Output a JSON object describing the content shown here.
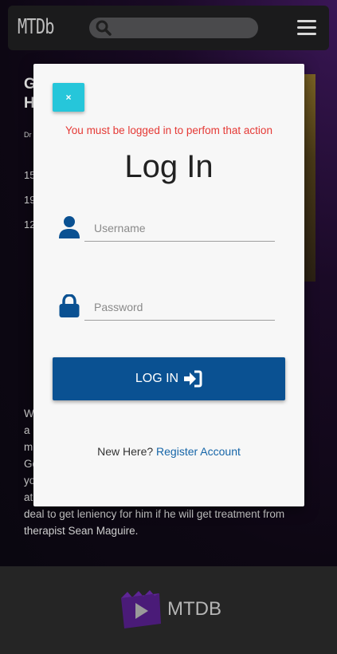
{
  "navbar": {
    "logo": "MTDb",
    "search_placeholder": "",
    "search_icon": "search-icon",
    "menu_icon": "hamburger-menu-icon"
  },
  "background": {
    "title_line1": "G",
    "title_line2": "H",
    "subtitle": "Dr",
    "lines": [
      "15",
      "19",
      "12"
    ],
    "paragraph_lines": [
      "W",
      "a",
      "m",
      "Go",
      "yo",
      "at"
    ],
    "paragraph_tail_1": "deal to get leniency for him if he will get treatment from",
    "paragraph_tail_2": "therapist Sean Maguire."
  },
  "modal": {
    "close_label": "×",
    "error_message": "You must be logged in to perfom that action",
    "title": "Log In",
    "username_placeholder": "Username",
    "password_placeholder": "Password",
    "login_label": "LOG IN",
    "new_here_text": "New Here?",
    "register_link": "Register Account"
  },
  "footer": {
    "brand": "MTDB"
  },
  "colors": {
    "accent_primary": "#0a5192",
    "close_button": "#26c6da",
    "error": "#e53935",
    "link": "#1565a8"
  }
}
